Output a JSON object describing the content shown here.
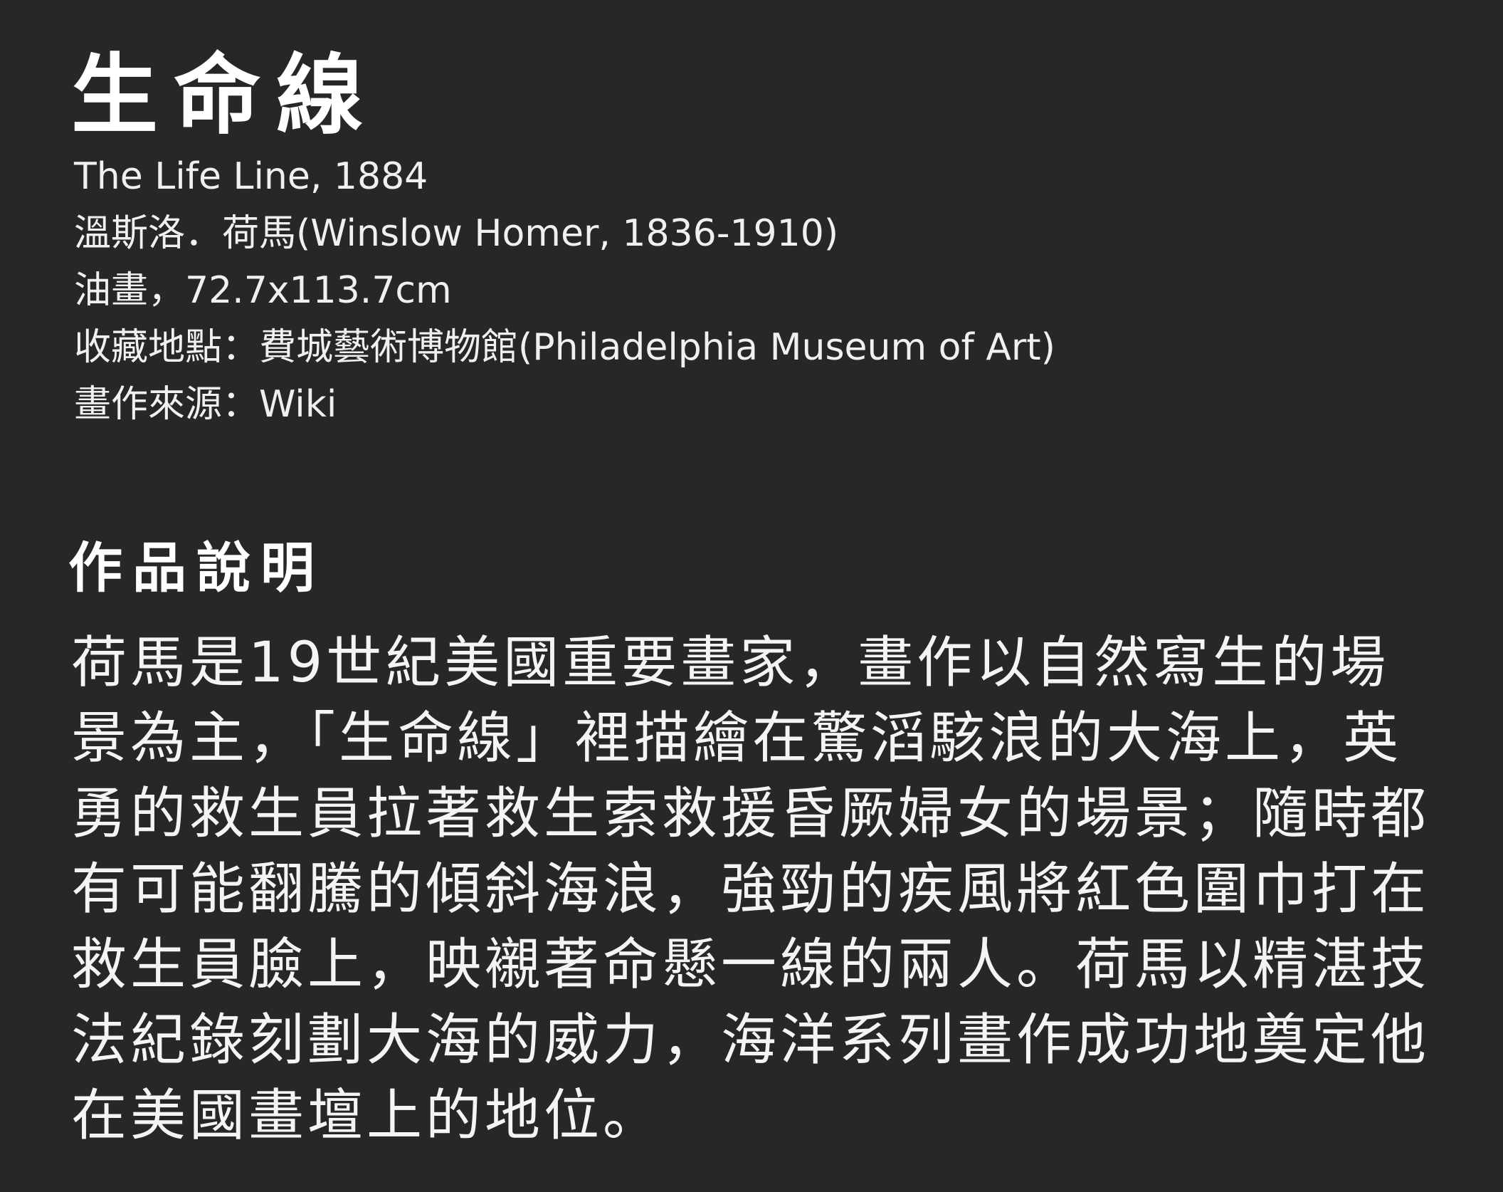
{
  "artwork": {
    "title": "生命線",
    "meta": {
      "english_title": "The Life Line, 1884",
      "artist": "溫斯洛．荷馬(Winslow Homer, 1836-1910)",
      "medium": "油畫，72.7x113.7cm",
      "location": "收藏地點：費城藝術博物館(Philadelphia Museum of Art)",
      "source": "畫作來源：Wiki"
    }
  },
  "description": {
    "heading": "作品說明",
    "body": "荷馬是19世紀美國重要畫家，畫作以自然寫生的場景為主，「生命線」裡描繪在驚滔駭浪的大海上，英勇的救生員拉著救生索救援昏厥婦女的場景；隨時都有可能翻騰的傾斜海浪，強勁的疾風將紅色圍巾打在救生員臉上，映襯著命懸一線的兩人。荷馬以精湛技法紀錄刻劃大海的威力，海洋系列畫作成功地奠定他在美國畫壇上的地位。"
  }
}
